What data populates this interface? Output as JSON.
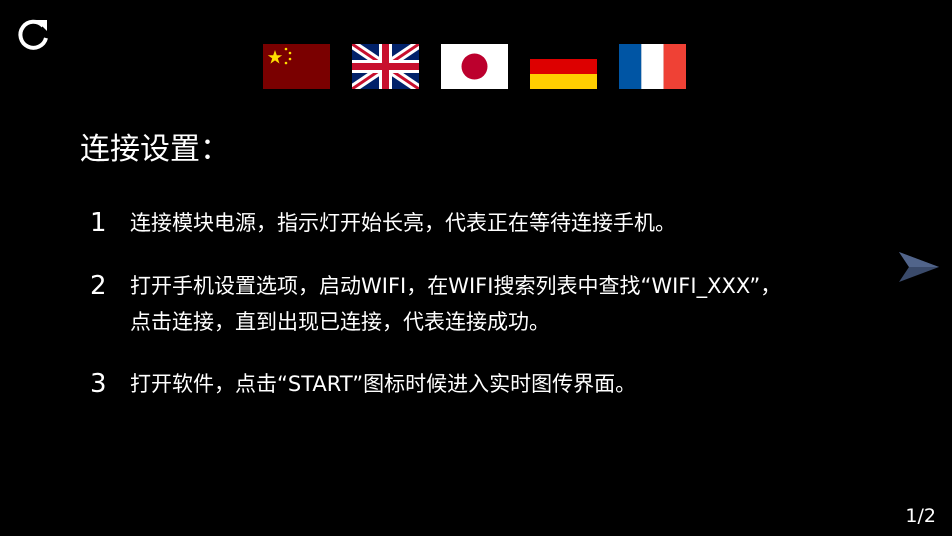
{
  "controls": {
    "refresh_icon": "refresh-icon",
    "next_icon": "arrow-right-icon"
  },
  "languages": [
    {
      "name": "chinese-flag",
      "colors": [
        "#7a0000",
        "#ffde00"
      ]
    },
    {
      "name": "uk-flag",
      "colors": [
        "#012169",
        "#ffffff",
        "#c8102e"
      ]
    },
    {
      "name": "japan-flag",
      "colors": [
        "#ffffff",
        "#bc002d"
      ]
    },
    {
      "name": "germany-flag",
      "colors": [
        "#000000",
        "#dd0000",
        "#ffce00"
      ]
    },
    {
      "name": "france-flag",
      "colors": [
        "#0055a4",
        "#ffffff",
        "#ef4135"
      ]
    }
  ],
  "title": "连接设置：",
  "steps": [
    {
      "number": "1",
      "lines": [
        "连接模块电源，指示灯开始长亮，代表正在等待连接手机。"
      ]
    },
    {
      "number": "2",
      "lines": [
        "打开手机设置选项，启动WIFI，在WIFI搜索列表中查找“WIFI_XXX”，",
        "点击连接，直到出现已连接，代表连接成功。"
      ]
    },
    {
      "number": "3",
      "lines": [
        "打开软件，点击“START”图标时候进入实时图传界面。"
      ]
    }
  ],
  "page_indicator": "1/2",
  "colors": {
    "background": "#000000",
    "text": "#ffffff",
    "next_arrow": "#3a4a6a"
  }
}
